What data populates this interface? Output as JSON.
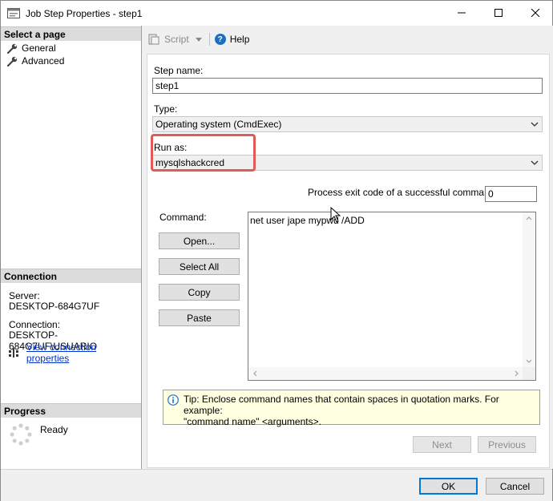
{
  "window": {
    "title": "Job Step Properties - step1",
    "controls": {
      "minimize_icon": "minimize-icon",
      "maximize_icon": "maximize-icon",
      "close_icon": "close-icon"
    }
  },
  "sidebar": {
    "select_page_header": "Select a page",
    "pages": [
      {
        "label": "General",
        "icon": "wrench-icon"
      },
      {
        "label": "Advanced",
        "icon": "wrench-icon"
      }
    ],
    "connection_header": "Connection",
    "server_label": "Server:",
    "server_value": "DESKTOP-684G7UF",
    "connection_label": "Connection:",
    "connection_value": "DESKTOP-684G7UF\\USUARIO",
    "view_connection_link": "View connection properties",
    "progress_header": "Progress",
    "progress_status": "Ready"
  },
  "toolbar": {
    "script_label": "Script",
    "help_label": "Help"
  },
  "form": {
    "step_name_label": "Step name:",
    "step_name_value": "step1",
    "type_label": "Type:",
    "type_value": "Operating system (CmdExec)",
    "run_as_label": "Run as:",
    "run_as_value": "mysqlshackcred",
    "exit_code_label": "Process exit code of a successful command:",
    "exit_code_value": "0",
    "command_label": "Command:",
    "command_value": "net user jape mypwd /ADD",
    "open_button": "Open...",
    "select_all_button": "Select All",
    "copy_button": "Copy",
    "paste_button": "Paste",
    "tip_text_line1": "Tip: Enclose command names that contain spaces in quotation marks. For example:",
    "tip_text_line2": "\"command name\" <arguments>.",
    "next_button": "Next",
    "previous_button": "Previous"
  },
  "footer": {
    "ok_button": "OK",
    "cancel_button": "Cancel"
  },
  "colors": {
    "highlight": "#e05a5a",
    "link": "#0033cc",
    "tip_background": "#ffffe1",
    "help_icon": "#1e6fc4",
    "ok_border": "#0078d7"
  }
}
